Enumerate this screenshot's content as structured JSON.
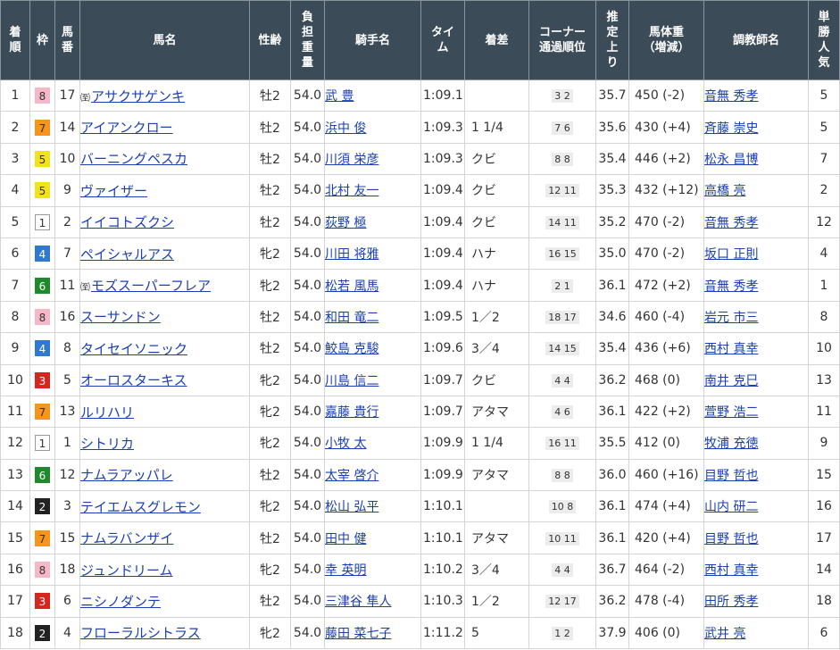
{
  "headers": {
    "rank": "着順",
    "frame": "枠",
    "number": "馬番",
    "horse": "馬名",
    "sex_age": "性齢",
    "weight_carried": "負担重量",
    "jockey": "騎手名",
    "time": "タイム",
    "margin": "着差",
    "corner_line1": "コーナー",
    "corner_line2": "通過順位",
    "last3f": "推定上り",
    "body_weight_line1": "馬体重",
    "body_weight_line2": "（増減）",
    "trainer": "調教師名",
    "popularity": "単勝人気"
  },
  "frame_colors": {
    "1": {
      "bg": "#ffffff",
      "fg": "#333333",
      "border": "#999999"
    },
    "2": {
      "bg": "#222222",
      "fg": "#ffffff",
      "border": "#222222"
    },
    "3": {
      "bg": "#d7261e",
      "fg": "#ffffff",
      "border": "#d7261e"
    },
    "4": {
      "bg": "#2f79d0",
      "fg": "#ffffff",
      "border": "#2f79d0"
    },
    "5": {
      "bg": "#f2e21c",
      "fg": "#333333",
      "border": "#f2e21c"
    },
    "6": {
      "bg": "#1f8a2c",
      "fg": "#ffffff",
      "border": "#1f8a2c"
    },
    "7": {
      "bg": "#f7941d",
      "fg": "#333333",
      "border": "#f7941d"
    },
    "8": {
      "bg": "#f6b7c9",
      "fg": "#333333",
      "border": "#f6b7c9"
    }
  },
  "rows": [
    {
      "rank": "1",
      "frame": "8",
      "number": "17",
      "foreign_mark": "㉃",
      "horse": "アサクサゲンキ",
      "sex_age": "牡2",
      "weight": "54.0",
      "jockey": "武 豊",
      "time": "1:09.1",
      "margin": "",
      "corner": "3 2",
      "last3f": "35.7",
      "body_weight": "450 (-2)",
      "trainer": "音無 秀孝",
      "popularity": "5"
    },
    {
      "rank": "2",
      "frame": "7",
      "number": "14",
      "foreign_mark": "",
      "horse": "アイアンクロー",
      "sex_age": "牡2",
      "weight": "54.0",
      "jockey": "浜中 俊",
      "time": "1:09.3",
      "margin": "1 1/4",
      "corner": "7 6",
      "last3f": "35.6",
      "body_weight": "430 (+4)",
      "trainer": "斉藤 崇史",
      "popularity": "5"
    },
    {
      "rank": "3",
      "frame": "5",
      "number": "10",
      "foreign_mark": "",
      "horse": "バーニングペスカ",
      "sex_age": "牡2",
      "weight": "54.0",
      "jockey": "川須 栄彦",
      "time": "1:09.3",
      "margin": "クビ",
      "corner": "8 8",
      "last3f": "35.4",
      "body_weight": "446 (+2)",
      "trainer": "松永 昌博",
      "popularity": "7"
    },
    {
      "rank": "4",
      "frame": "5",
      "number": "9",
      "foreign_mark": "",
      "horse": "ヴァイザー",
      "sex_age": "牡2",
      "weight": "54.0",
      "jockey": "北村 友一",
      "time": "1:09.4",
      "margin": "クビ",
      "corner": "12 11",
      "last3f": "35.3",
      "body_weight": "432 (+12)",
      "trainer": "高橋 亮",
      "popularity": "2"
    },
    {
      "rank": "5",
      "frame": "1",
      "number": "2",
      "foreign_mark": "",
      "horse": "イイコトズクシ",
      "sex_age": "牡2",
      "weight": "54.0",
      "jockey": "荻野 極",
      "time": "1:09.4",
      "margin": "クビ",
      "corner": "14 11",
      "last3f": "35.2",
      "body_weight": "470 (-2)",
      "trainer": "音無 秀孝",
      "popularity": "12"
    },
    {
      "rank": "6",
      "frame": "4",
      "number": "7",
      "foreign_mark": "",
      "horse": "ペイシャルアス",
      "sex_age": "牝2",
      "weight": "54.0",
      "jockey": "川田 将雅",
      "time": "1:09.4",
      "margin": "ハナ",
      "corner": "16 15",
      "last3f": "35.0",
      "body_weight": "470 (-2)",
      "trainer": "坂口 正則",
      "popularity": "4"
    },
    {
      "rank": "7",
      "frame": "6",
      "number": "11",
      "foreign_mark": "㉃",
      "horse": "モズスーパーフレア",
      "sex_age": "牝2",
      "weight": "54.0",
      "jockey": "松若 風馬",
      "time": "1:09.4",
      "margin": "ハナ",
      "corner": "2 1",
      "last3f": "36.1",
      "body_weight": "472 (+2)",
      "trainer": "音無 秀孝",
      "popularity": "1"
    },
    {
      "rank": "8",
      "frame": "8",
      "number": "16",
      "foreign_mark": "",
      "horse": "スーサンドン",
      "sex_age": "牡2",
      "weight": "54.0",
      "jockey": "和田 竜二",
      "time": "1:09.5",
      "margin": "1／2",
      "corner": "18 17",
      "last3f": "34.6",
      "body_weight": "460 (-4)",
      "trainer": "岩元 市三",
      "popularity": "8"
    },
    {
      "rank": "9",
      "frame": "4",
      "number": "8",
      "foreign_mark": "",
      "horse": "タイセイソニック",
      "sex_age": "牡2",
      "weight": "54.0",
      "jockey": "鮫島 克駿",
      "time": "1:09.6",
      "margin": "3／4",
      "corner": "14 15",
      "last3f": "35.4",
      "body_weight": "436 (+6)",
      "trainer": "西村 真幸",
      "popularity": "10"
    },
    {
      "rank": "10",
      "frame": "3",
      "number": "5",
      "foreign_mark": "",
      "horse": "オーロスターキス",
      "sex_age": "牝2",
      "weight": "54.0",
      "jockey": "川島 信二",
      "time": "1:09.7",
      "margin": "クビ",
      "corner": "4 4",
      "last3f": "36.2",
      "body_weight": "468 (0)",
      "trainer": "南井 克巳",
      "popularity": "13"
    },
    {
      "rank": "11",
      "frame": "7",
      "number": "13",
      "foreign_mark": "",
      "horse": "ルリハリ",
      "sex_age": "牝2",
      "weight": "54.0",
      "jockey": "嘉藤 貴行",
      "time": "1:09.7",
      "margin": "アタマ",
      "corner": "4 6",
      "last3f": "36.1",
      "body_weight": "422 (+2)",
      "trainer": "萱野 浩二",
      "popularity": "11"
    },
    {
      "rank": "12",
      "frame": "1",
      "number": "1",
      "foreign_mark": "",
      "horse": "シトリカ",
      "sex_age": "牝2",
      "weight": "54.0",
      "jockey": "小牧 太",
      "time": "1:09.9",
      "margin": "1 1/4",
      "corner": "16 11",
      "last3f": "35.5",
      "body_weight": "412 (0)",
      "trainer": "牧浦 充徳",
      "popularity": "9"
    },
    {
      "rank": "13",
      "frame": "6",
      "number": "12",
      "foreign_mark": "",
      "horse": "ナムラアッパレ",
      "sex_age": "牡2",
      "weight": "54.0",
      "jockey": "太宰 啓介",
      "time": "1:09.9",
      "margin": "アタマ",
      "corner": "8 8",
      "last3f": "36.0",
      "body_weight": "460 (+16)",
      "trainer": "目野 哲也",
      "popularity": "15"
    },
    {
      "rank": "14",
      "frame": "2",
      "number": "3",
      "foreign_mark": "",
      "horse": "テイエムスグレモン",
      "sex_age": "牝2",
      "weight": "54.0",
      "jockey": "松山 弘平",
      "time": "1:10.1",
      "margin": "",
      "corner": "10 8",
      "last3f": "36.1",
      "body_weight": "474 (+4)",
      "trainer": "山内 研二",
      "popularity": "16"
    },
    {
      "rank": "15",
      "frame": "7",
      "number": "15",
      "foreign_mark": "",
      "horse": "ナムラバンザイ",
      "sex_age": "牡2",
      "weight": "54.0",
      "jockey": "田中 健",
      "time": "1:10.1",
      "margin": "アタマ",
      "corner": "10 11",
      "last3f": "36.1",
      "body_weight": "420 (+4)",
      "trainer": "目野 哲也",
      "popularity": "17"
    },
    {
      "rank": "16",
      "frame": "8",
      "number": "18",
      "foreign_mark": "",
      "horse": "ジュンドリーム",
      "sex_age": "牝2",
      "weight": "54.0",
      "jockey": "幸 英明",
      "time": "1:10.2",
      "margin": "3／4",
      "corner": "4 4",
      "last3f": "36.7",
      "body_weight": "464 (-2)",
      "trainer": "西村 真幸",
      "popularity": "14"
    },
    {
      "rank": "17",
      "frame": "3",
      "number": "6",
      "foreign_mark": "",
      "horse": "ニシノダンテ",
      "sex_age": "牡2",
      "weight": "54.0",
      "jockey": "三津谷 隼人",
      "time": "1:10.3",
      "margin": "1／2",
      "corner": "12 17",
      "last3f": "36.2",
      "body_weight": "478 (-4)",
      "trainer": "田所 秀孝",
      "popularity": "18"
    },
    {
      "rank": "18",
      "frame": "2",
      "number": "4",
      "foreign_mark": "",
      "horse": "フローラルシトラス",
      "sex_age": "牝2",
      "weight": "54.0",
      "jockey": "藤田 菜七子",
      "time": "1:11.2",
      "margin": "5",
      "corner": "1 2",
      "last3f": "37.9",
      "body_weight": "406 (0)",
      "trainer": "武井 亮",
      "popularity": "6"
    }
  ]
}
